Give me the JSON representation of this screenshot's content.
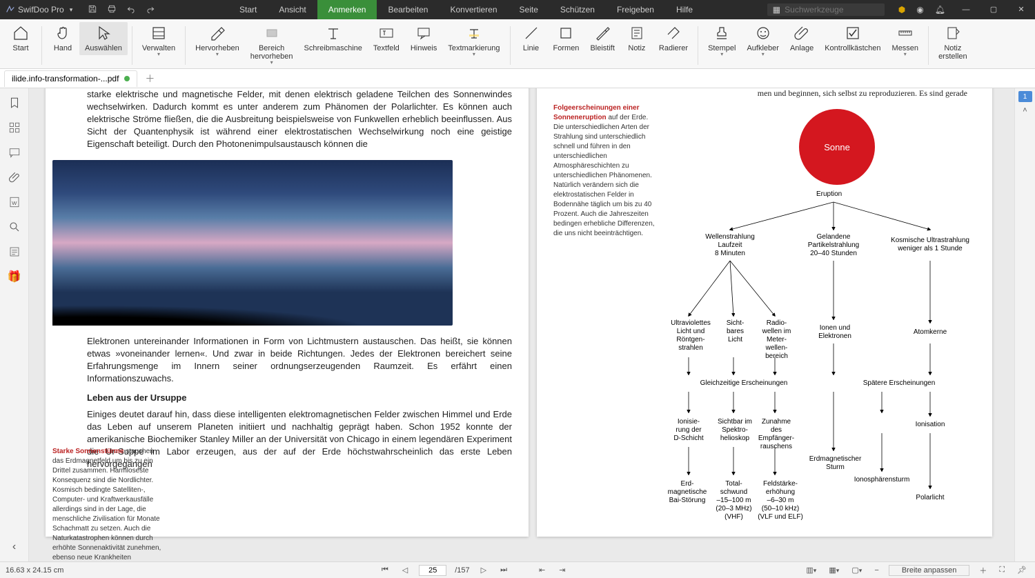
{
  "app": {
    "name": "SwifDoo Pro"
  },
  "menu": [
    "Start",
    "Ansicht",
    "Anmerken",
    "Bearbeiten",
    "Konvertieren",
    "Seite",
    "Schützen",
    "Freigeben",
    "Hilfe"
  ],
  "menu_active_index": 2,
  "search_placeholder": "Suchwerkzeuge",
  "ribbon": [
    {
      "key": "start",
      "label": "Start"
    },
    {
      "key": "hand",
      "label": "Hand"
    },
    {
      "key": "select",
      "label": "Auswählen"
    },
    {
      "key": "manage",
      "label": "Verwalten",
      "dd": true
    },
    {
      "key": "highlight",
      "label": "Hervorheben",
      "dd": true
    },
    {
      "key": "area",
      "label": "Bereich\nhervorheben",
      "dd": true
    },
    {
      "key": "typewriter",
      "label": "Schreibmaschine"
    },
    {
      "key": "textbox",
      "label": "Textfeld"
    },
    {
      "key": "note",
      "label": "Hinweis"
    },
    {
      "key": "textmark",
      "label": "Textmarkierung",
      "dd": true
    },
    {
      "key": "line",
      "label": "Linie"
    },
    {
      "key": "shapes",
      "label": "Formen"
    },
    {
      "key": "pencil",
      "label": "Bleistift"
    },
    {
      "key": "notiz",
      "label": "Notiz"
    },
    {
      "key": "eraser",
      "label": "Radierer"
    },
    {
      "key": "stamp",
      "label": "Stempel",
      "dd": true
    },
    {
      "key": "sticker",
      "label": "Aufkleber",
      "dd": true
    },
    {
      "key": "attach",
      "label": "Anlage"
    },
    {
      "key": "checkbox",
      "label": "Kontrollkästchen"
    },
    {
      "key": "measure",
      "label": "Messen",
      "dd": true
    },
    {
      "key": "createnote",
      "label": "Notiz\nerstellen"
    }
  ],
  "ribbon_selected_key": "select",
  "tab": {
    "title": "ilide.info-transformation-...pdf",
    "modified": true
  },
  "doc": {
    "p1": "starke elektrische und magnetische Felder, mit denen elektrisch geladene Teilchen des Sonnenwindes wechselwirken. Dadurch kommt es unter anderem zum Phänomen der Polarlichter. Es können auch elektrische Ströme fließen, die die Ausbreitung beispielsweise von Funkwellen erheblich beeinflussen. Aus Sicht der Quantenphysik ist während einer elektrostatischen Wechselwirkung noch eine geistige Eigenschaft beteiligt. Durch den Photonenimpulsaustausch können die",
    "p2": "Elektronen untereinander Informationen in Form von Lichtmustern austauschen. Das heißt, sie können etwas »voneinander lernen«. Und zwar in beide Richtungen. Jedes der Elektronen bereichert seine Erfahrungsmenge im Innern seiner ordnungserzeugenden Raumzeit. Es erfährt einen Informationszuwachs.",
    "h2": "Leben aus der Ursuppe",
    "p3": "Einiges deutet darauf hin, dass diese intelligenten elektromagnetischen Felder zwischen Himmel und Erde das Leben auf unserem Planeten initiiert und nachhaltig geprägt haben. Schon 1952 konnte der amerikanische Biochemiker Stanley Miller an der Universität von Chicago in einem legendären Experiment die Ur-Suppe im Labor erzeugen, aus der auf der Erde höchstwahrscheinlich das erste Leben hervorgegangen",
    "caption_title": "Starke Sonnenstürme",
    "caption_body": " stauchen das Erdmagnetfeld um bis zu ein Drittel zusammen. Harmloseste Konsequenz sind die Nordlichter. Kosmisch bedingte Satelliten-, Computer- und Kraftwerkausfälle allerdings sind in der Lage, die menschliche Zivilisation für Monate Schachmatt zu setzen. Auch die Naturkatastrophen können durch erhöhte Sonnenaktivität zunehmen, ebenso neue Krankheiten entstehen.",
    "right_top": "men und beginnen, sich selbst zu reproduzieren. Es sind gerade",
    "r_caption_title": "Folgeerscheinungen einer Sonneneruption",
    "r_caption_body": " auf der Erde. Die unterschiedlichen Arten der Strahlung sind unterschiedlich schnell und führen in den unterschiedlichen Atmosphäreschichten zu unterschiedlichen Phänomenen. Natürlich verändern sich die elektrostatischen Felder in Bodennähe täglich um bis zu 40 Prozent. Auch die Jahreszeiten bedingen erhebliche Differenzen, die uns nicht beeinträchtigen.",
    "diagram": {
      "sun": "Sonne",
      "eruption": "Eruption",
      "b1": "Wellenstrahlung\nLaufzeit\n8 Minuten",
      "b2": "Gelandene\nPartikelstrahlung\n20–40 Stunden",
      "b3": "Kosmische Ultrastrahlung\nweniger als 1 Stunde",
      "c1": "Ultraviolettes\nLicht und\nRöntgen-\nstrahlen",
      "c2": "Sicht-\nbares\nLicht",
      "c3": "Radio-\nwellen im\nMeter-\nwellen-\nbereich",
      "c4": "Ionen und\nElektronen",
      "c5": "Atomkerne",
      "mid1": "Gleichzeitige Erscheinungen",
      "mid2": "Spätere Erscheinungen",
      "d1": "Ionisie-\nrung der\nD-Schicht",
      "d2": "Sichtbar im\nSpektro-\nhelioskop",
      "d3": "Zunahme\ndes\nEmpfänger-\nrauschens",
      "d4": "Erdmagnetischer\nSturm",
      "d5": "Ionisation",
      "e1": "Erd-\nmagnetische\nBai-Störung",
      "e2": "Total-\nschwund\n–15–100 m\n(20–3 MHz)\n(VHF)",
      "e3": "Feldstärke-\nerhöhung\n–6–30 m\n(50–10 kHz)\n(VLF und ELF)",
      "e4": "Ionosphärensturm",
      "e5": "Polarlicht"
    }
  },
  "pagenav": {
    "current": "25",
    "total": "/157",
    "thumb": "1"
  },
  "status": {
    "dims": "16.63 x 24.15 cm",
    "fit": "Breite anpassen"
  }
}
